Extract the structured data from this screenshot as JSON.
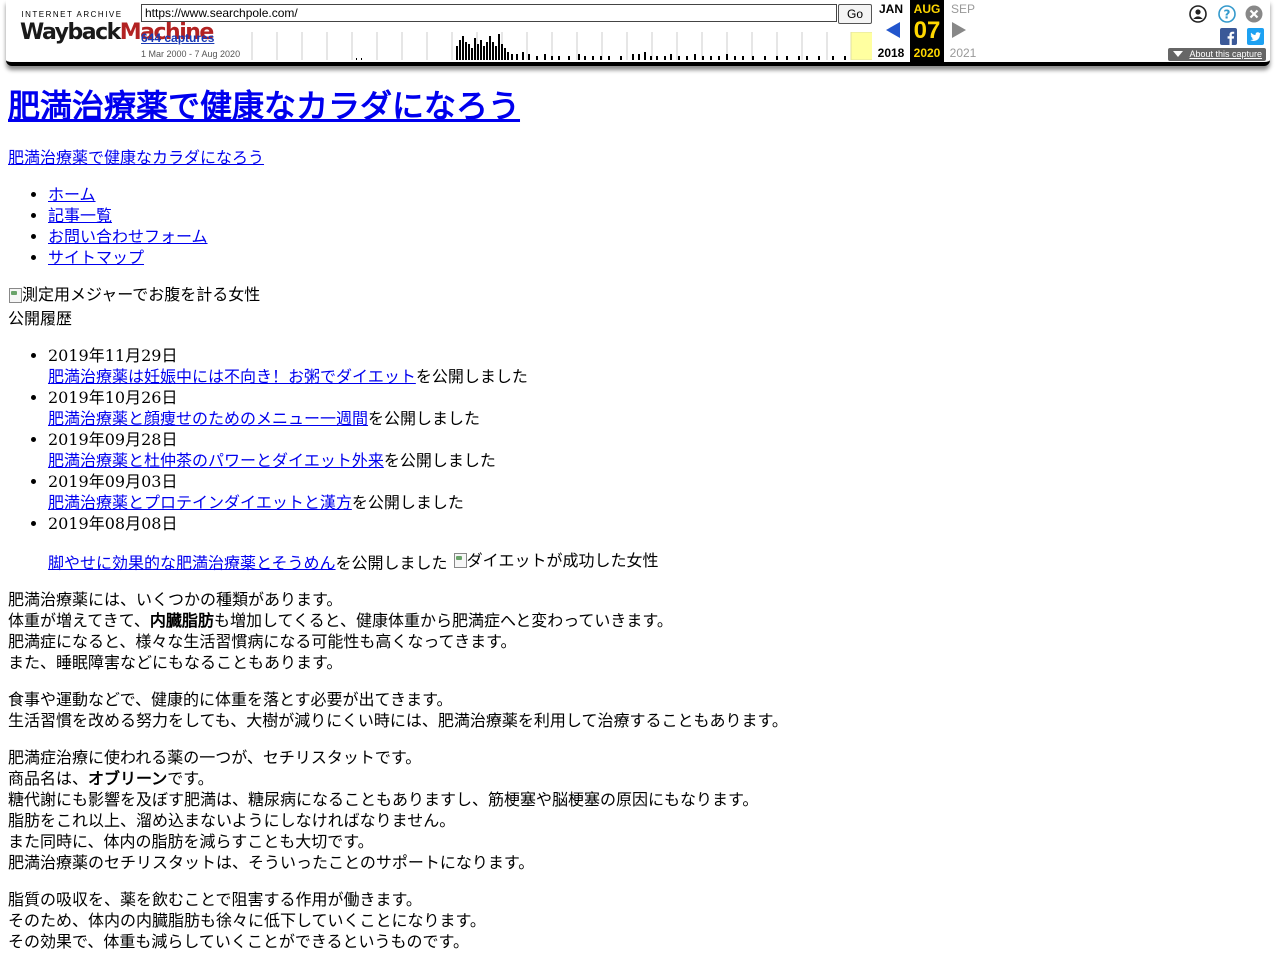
{
  "toolbar": {
    "logo_top": "INTERNET ARCHIVE",
    "logo_main_a": "Wayback",
    "logo_main_b": "Machine",
    "url": "https://www.searchpole.com/",
    "go_label": "Go",
    "captures": "644 captures",
    "range": "1 Mar 2000 - 7 Aug 2020",
    "prev_month": "JAN",
    "prev_year": "2018",
    "cur_month": "AUG",
    "cur_day": "07",
    "cur_year": "2020",
    "next_month": "SEP",
    "next_year": "2021",
    "about": "About this capture",
    "icons": [
      "user-icon",
      "help-icon",
      "close-icon",
      "facebook-icon",
      "twitter-icon"
    ]
  },
  "site": {
    "title": "肥満治療薬で健康なカラダになろう",
    "subtitle_link": "肥満治療薬で健康なカラダになろう",
    "nav": [
      "ホーム",
      "記事一覧",
      "お問い合わせフォーム",
      "サイトマップ"
    ],
    "hero_alt": "測定用メジャーでお腹を計る女性",
    "history_heading": "公開履歴",
    "history": [
      {
        "date": "2019年11月29日",
        "link": "肥満治療薬は妊娠中には不向き！お粥でダイエット",
        "suffix": "を公開しました"
      },
      {
        "date": "2019年10月26日",
        "link": "肥満治療薬と顔痩せのためのメニュー一週間",
        "suffix": "を公開しました"
      },
      {
        "date": "2019年09月28日",
        "link": "肥満治療薬と杜仲茶のパワーとダイエット外来",
        "suffix": "を公開しました"
      },
      {
        "date": "2019年09月03日",
        "link": "肥満治療薬とプロテインダイエットと漢方",
        "suffix": "を公開しました"
      },
      {
        "date": "2019年08月08日",
        "link": "脚やせに効果的な肥満治療薬とそうめん",
        "suffix": "を公開しました"
      }
    ],
    "history_img_alt": "ダイエットが成功した女性",
    "para1": {
      "l1": "肥満治療薬には、いくつかの種類があります。",
      "l2_pre": "体重が増えてきて、",
      "l2_bold": "内臓脂肪",
      "l2_post": "も増加してくると、健康体重から肥満症へと変わっていきます。",
      "l3": "肥満症になると、様々な生活習慣病になる可能性も高くなってきます。",
      "l4": "また、睡眠障害などにもなることもあります。"
    },
    "para2": {
      "l1": "食事や運動などで、健康的に体重を落とす必要が出てきます。",
      "l2": "生活習慣を改める努力をしても、大樹が減りにくい時には、肥満治療薬を利用して治療することもあります。"
    },
    "para3": {
      "l1": "肥満症治療に使われる薬の一つが、セチリスタットです。",
      "l2_pre": "商品名は、",
      "l2_bold": "オブリーン",
      "l2_post": "です。",
      "l3": "糖代謝にも影響を及ぼす肥満は、糖尿病になることもありますし、筋梗塞や脳梗塞の原因にもなります。",
      "l4": "脂肪をこれ以上、溜め込まないようにしなければなりません。",
      "l5": "また同時に、体内の脂肪を減らすことも大切です。",
      "l6": "肥満治療薬のセチリスタットは、そういったことのサポートになります。"
    },
    "para4": {
      "l1": "脂質の吸収を、薬を飲むことで阻害する作用が働きます。",
      "l2": "そのため、体内の内臓脂肪も徐々に低下していくことになります。",
      "l3": "その効果で、体重も減らしていくことができるというものです。"
    }
  }
}
